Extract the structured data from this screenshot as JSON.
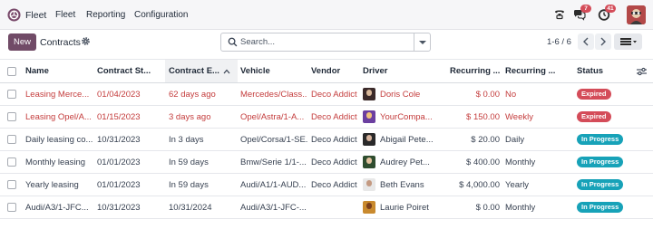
{
  "navbar": {
    "app_name": "Fleet",
    "menu": [
      "Fleet",
      "Reporting",
      "Configuration"
    ],
    "messages_badge": "7",
    "activities_badge": "41"
  },
  "control_panel": {
    "new_label": "New",
    "breadcrumb": "Contracts",
    "search_placeholder": "Search...",
    "pager": "1-6 / 6"
  },
  "table": {
    "columns": [
      "Name",
      "Contract St...",
      "Contract E...",
      "Vehicle",
      "Vendor",
      "Driver",
      "Recurring ...",
      "Recurring ...",
      "Status"
    ],
    "rows": [
      {
        "name": "Leasing Merce...",
        "start": "01/04/2023",
        "end": "62 days ago",
        "vehicle": "Mercedes/Class...",
        "vendor": "Deco Addict",
        "driver": "Doris Cole",
        "cost": "$ 0.00",
        "frequency": "No",
        "status": "Expired",
        "overdue": true
      },
      {
        "name": "Leasing Opel/A...",
        "start": "01/15/2023",
        "end": "3 days ago",
        "vehicle": "Opel/Astra/1-A...",
        "vendor": "Deco Addict",
        "driver": "YourCompa...",
        "cost": "$ 150.00",
        "frequency": "Weekly",
        "status": "Expired",
        "overdue": true
      },
      {
        "name": "Daily leasing co...",
        "start": "10/31/2023",
        "end": "In 3 days",
        "vehicle": "Opel/Corsa/1-SE...",
        "vendor": "Deco Addict",
        "driver": "Abigail Pete...",
        "cost": "$ 20.00",
        "frequency": "Daily",
        "status": "In Progress",
        "overdue": false
      },
      {
        "name": "Monthly leasing",
        "start": "01/01/2023",
        "end": "In 59 days",
        "vehicle": "Bmw/Serie 1/1-...",
        "vendor": "Deco Addict",
        "driver": "Audrey Pet...",
        "cost": "$ 400.00",
        "frequency": "Monthly",
        "status": "In Progress",
        "overdue": false
      },
      {
        "name": "Yearly leasing",
        "start": "01/01/2023",
        "end": "In 59 days",
        "vehicle": "Audi/A1/1-AUD...",
        "vendor": "Deco Addict",
        "driver": "Beth Evans",
        "cost": "$ 4,000.00",
        "frequency": "Yearly",
        "status": "In Progress",
        "overdue": false
      },
      {
        "name": "Audi/A3/1-JFC...",
        "start": "10/31/2023",
        "end": "10/31/2024",
        "vehicle": "Audi/A3/1-JFC-...",
        "vendor": "",
        "driver": "Laurie Poiret",
        "cost": "$ 0.00",
        "frequency": "Monthly",
        "status": "In Progress",
        "overdue": false
      }
    ]
  },
  "colors": {
    "brand": "#714b67",
    "overdue_text": "#c43d3d",
    "expired": "#d44c59",
    "in_progress": "#17a2b8"
  },
  "icons": {
    "app": "fleet-app-icon",
    "phone": "phone-icon",
    "messages": "chat-icon",
    "activities": "clock-icon",
    "settings": "gear-icon",
    "search": "search-icon",
    "view_switcher": "list-view-icon",
    "optional_columns": "column-options-icon"
  }
}
